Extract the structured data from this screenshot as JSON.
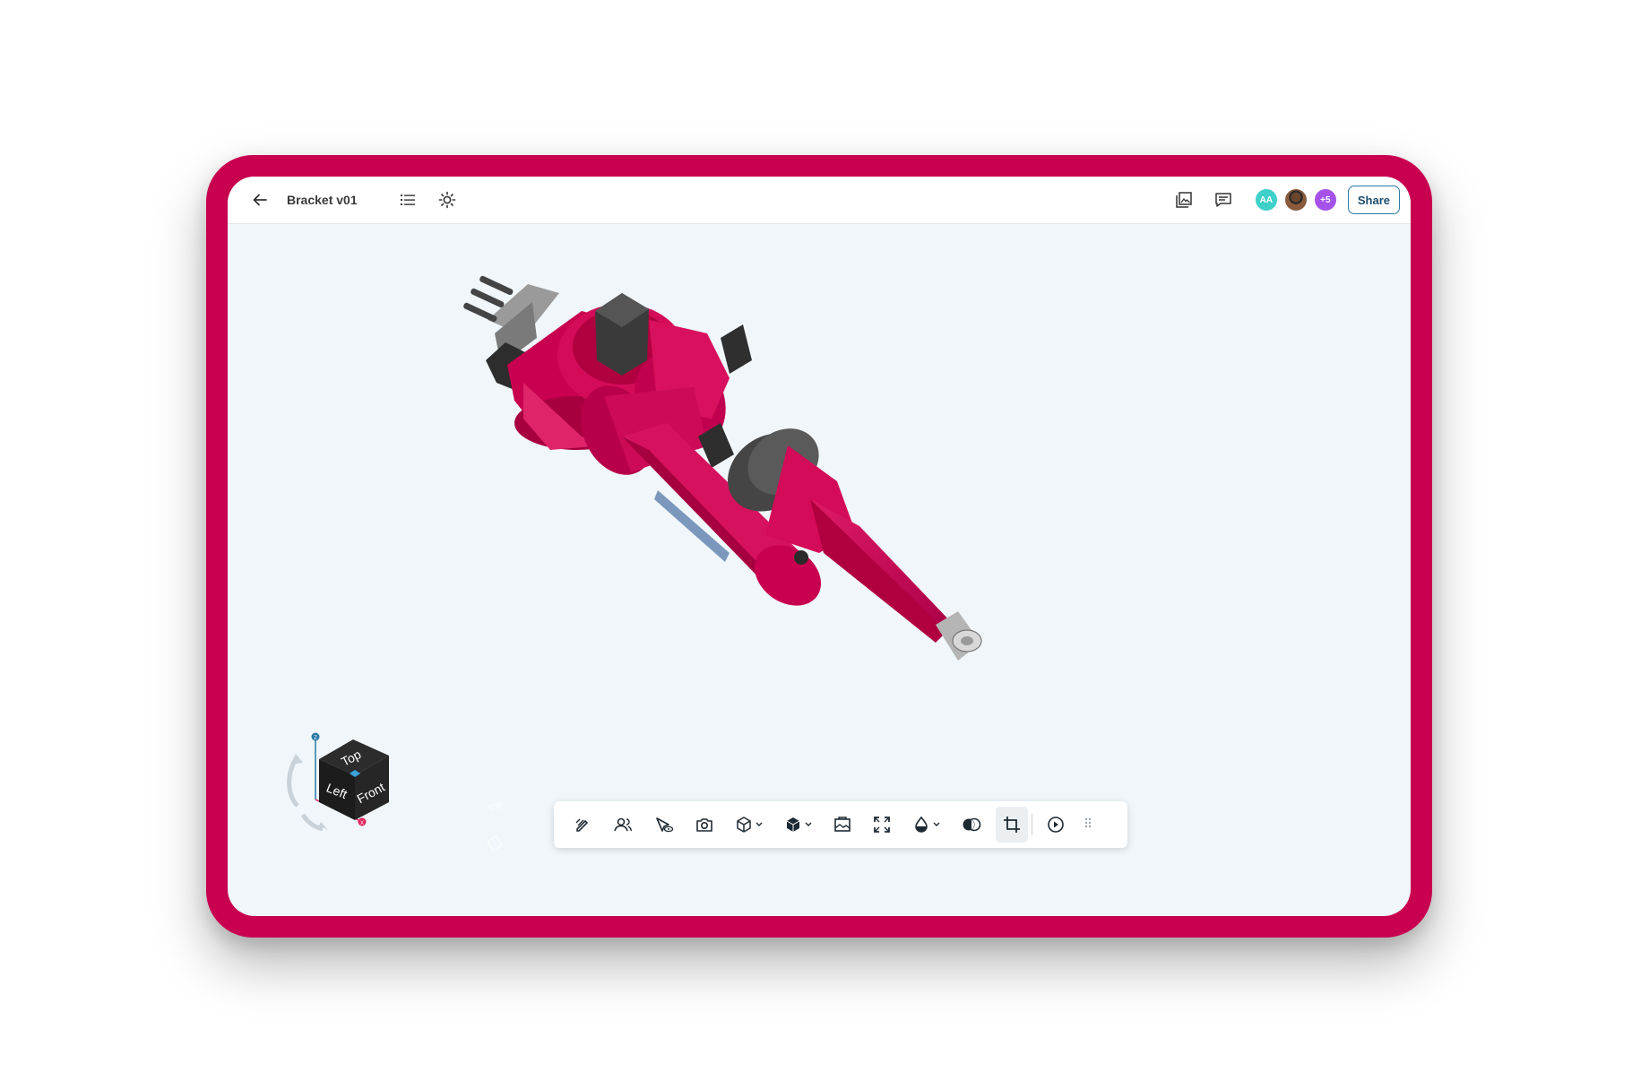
{
  "header": {
    "title": "Bracket v01",
    "share_label": "Share",
    "avatars": [
      {
        "initials": "AA",
        "color": "#3fd0c9"
      },
      {
        "initials": "",
        "type": "photo"
      },
      {
        "initials": "+5",
        "color": "#a552ea"
      }
    ]
  },
  "nav_cube": {
    "top": "Top",
    "left": "Left",
    "front": "Front",
    "axis_z": "Z",
    "axis_x": "X"
  },
  "ghost_cube": {
    "label": "Top"
  },
  "toolbar": {
    "tools": [
      "markup-icon",
      "users-icon",
      "select-view-icon",
      "camera-icon",
      "view-cube-icon",
      "shaded-cube-icon",
      "image-icon",
      "fit-screen-icon",
      "color-drop-icon",
      "compare-icon",
      "crop-icon",
      "play-icon",
      "grip-icon"
    ],
    "active": "crop-icon"
  },
  "colors": {
    "brand_frame": "#c8004f",
    "model_primary": "#d00b55",
    "viewport_bg": "#f0f6f9",
    "share_border": "#2b7aa6"
  }
}
